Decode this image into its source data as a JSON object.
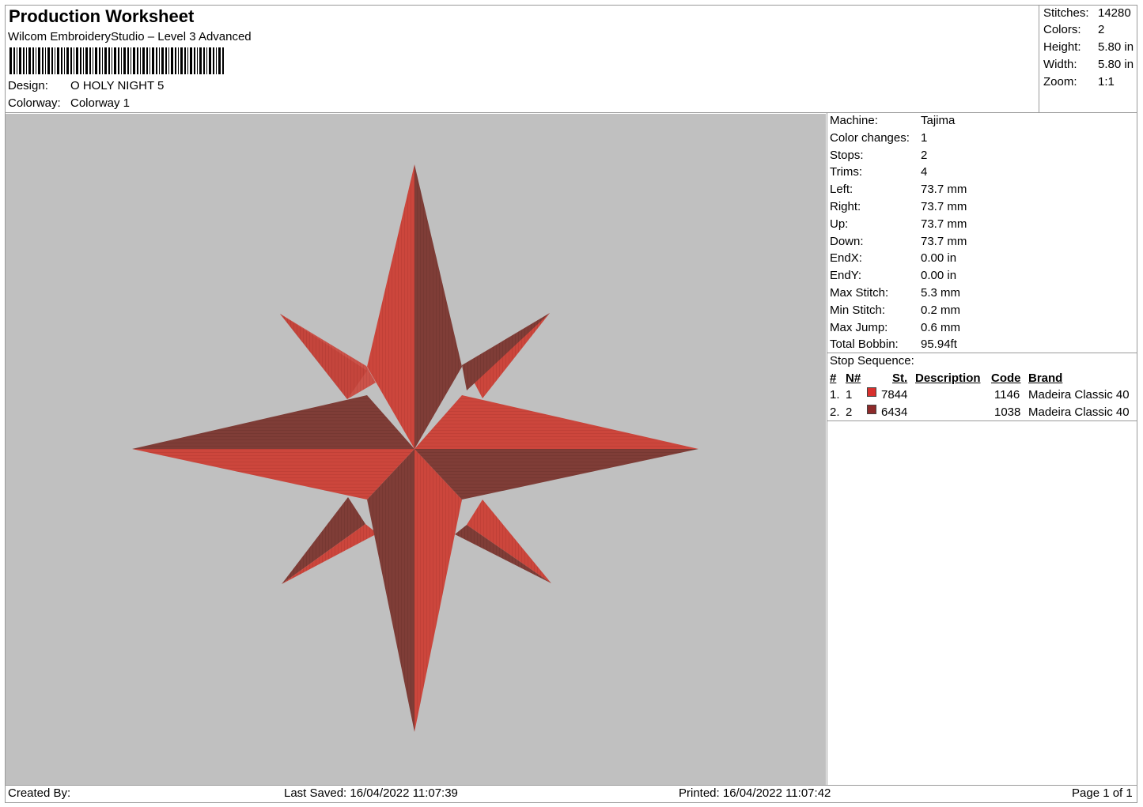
{
  "header": {
    "title": "Production Worksheet",
    "software": "Wilcom EmbroideryStudio – Level 3 Advanced",
    "design_label": "Design:",
    "design_value": "O HOLY NIGHT 5",
    "colorway_label": "Colorway:",
    "colorway_value": "Colorway 1"
  },
  "summary": {
    "stitches_label": "Stitches:",
    "stitches_value": "14280",
    "colors_label": "Colors:",
    "colors_value": "2",
    "height_label": "Height:",
    "height_value": "5.80 in",
    "width_label": "Width:",
    "width_value": "5.80 in",
    "zoom_label": "Zoom:",
    "zoom_value": "1:1"
  },
  "details": [
    {
      "label": "Machine:",
      "value": "Tajima"
    },
    {
      "label": "Color changes:",
      "value": "1"
    },
    {
      "label": "Stops:",
      "value": "2"
    },
    {
      "label": "Trims:",
      "value": "4"
    },
    {
      "label": "Left:",
      "value": "73.7 mm"
    },
    {
      "label": "Right:",
      "value": "73.7 mm"
    },
    {
      "label": "Up:",
      "value": "73.7 mm"
    },
    {
      "label": "Down:",
      "value": "73.7 mm"
    },
    {
      "label": "EndX:",
      "value": "0.00 in"
    },
    {
      "label": "EndY:",
      "value": "0.00 in"
    },
    {
      "label": "Max Stitch:",
      "value": "5.3 mm"
    },
    {
      "label": "Min Stitch:",
      "value": "0.2 mm"
    },
    {
      "label": "Max Jump:",
      "value": "0.6 mm"
    },
    {
      "label": "Total Bobbin:",
      "value": "95.94ft"
    }
  ],
  "stop_sequence": {
    "label": "Stop Sequence:",
    "columns": {
      "num": "#",
      "n": "N#",
      "st": "St.",
      "description": "Description",
      "code": "Code",
      "brand": "Brand"
    },
    "rows": [
      {
        "num": "1.",
        "n": "1",
        "color": "#d8302d",
        "st": "7844",
        "description": "",
        "code": "1146",
        "brand": "Madeira Classic 40"
      },
      {
        "num": "2.",
        "n": "2",
        "color": "#8e2b2b",
        "st": "6434",
        "description": "",
        "code": "1038",
        "brand": "Madeira Classic 40"
      }
    ]
  },
  "design_colors": {
    "light": "#c8453c",
    "dark": "#7e3c36",
    "background": "#c0c0c0"
  },
  "footer": {
    "created_by": "Created By:",
    "last_saved": "Last Saved: 16/04/2022 11:07:39",
    "printed": "Printed: 16/04/2022 11:07:42",
    "page": "Page 1 of 1"
  }
}
